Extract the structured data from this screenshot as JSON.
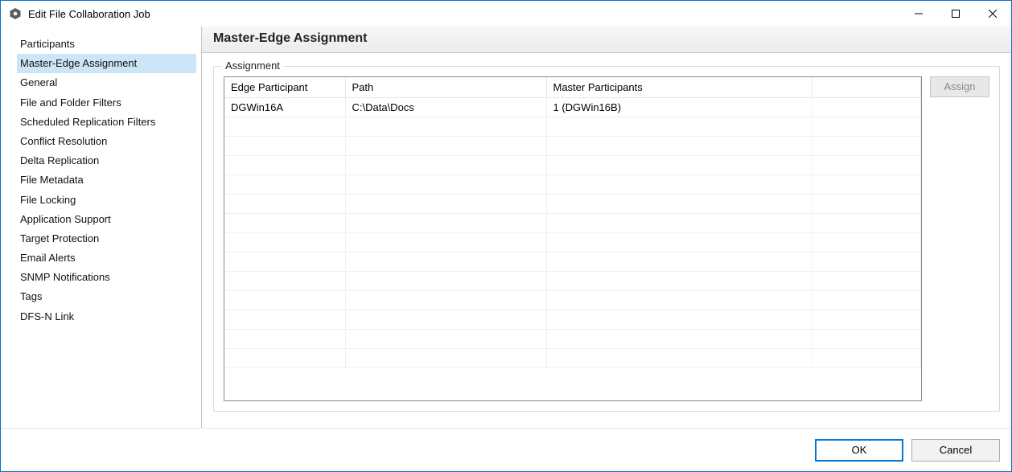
{
  "window": {
    "title": "Edit File Collaboration Job"
  },
  "sidebar": {
    "items": [
      {
        "label": "Participants"
      },
      {
        "label": "Master-Edge Assignment"
      },
      {
        "label": "General"
      },
      {
        "label": "File and Folder Filters"
      },
      {
        "label": "Scheduled Replication Filters"
      },
      {
        "label": "Conflict Resolution"
      },
      {
        "label": "Delta Replication"
      },
      {
        "label": "File Metadata"
      },
      {
        "label": "File Locking"
      },
      {
        "label": "Application Support"
      },
      {
        "label": "Target Protection"
      },
      {
        "label": "Email Alerts"
      },
      {
        "label": "SNMP Notifications"
      },
      {
        "label": "Tags"
      },
      {
        "label": "DFS-N Link"
      }
    ],
    "selected_index": 1
  },
  "content": {
    "heading": "Master-Edge Assignment",
    "group_label": "Assignment",
    "assign_button": "Assign",
    "columns": {
      "edge": "Edge Participant",
      "path": "Path",
      "master": "Master Participants"
    },
    "rows": [
      {
        "edge": "DGWin16A",
        "path": "C:\\Data\\Docs",
        "master": "1 (DGWin16B)"
      }
    ]
  },
  "footer": {
    "ok": "OK",
    "cancel": "Cancel"
  }
}
